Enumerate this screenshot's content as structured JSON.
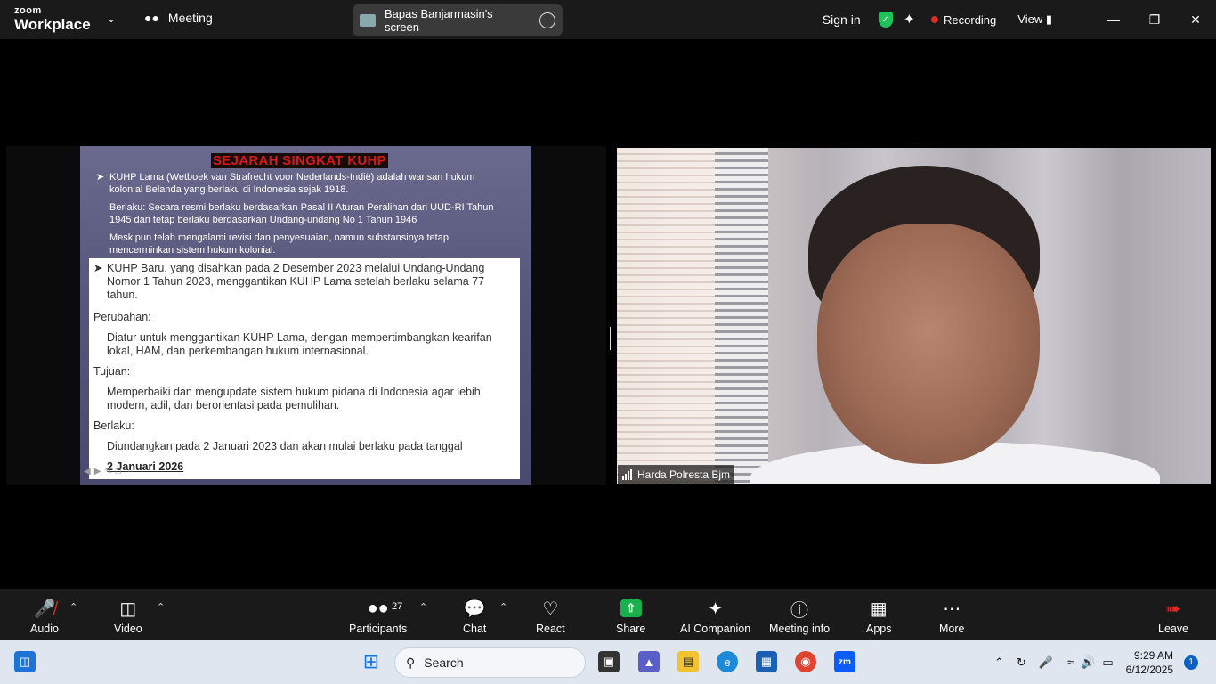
{
  "titlebar": {
    "logo_line1": "zoom",
    "logo_line2": "Workplace",
    "meeting_label": "Meeting",
    "shared_screen_label": "Bapas Banjarmasin's screen",
    "sign_in": "Sign in",
    "recording_label": "Recording",
    "view_label": "View",
    "recording_color": "#e02828",
    "shield_color": "#1fc35a"
  },
  "slide": {
    "title": "SEJARAH SINGKAT KUHP",
    "bullet1": "KUHP Lama (Wetboek van Strafrecht voor Nederlands-Indië) adalah warisan hukum kolonial Belanda yang berlaku di Indonesia sejak 1918.",
    "para2": "Berlaku: Secara resmi berlaku berdasarkan Pasal II Aturan Peralihan dari UUD-RI Tahun 1945 dan tetap berlaku berdasarkan Undang-undang No 1 Tahun 1946",
    "para3": "Meskipun telah mengalami revisi dan penyesuaian, namun substansinya tetap mencerminkan sistem hukum kolonial.",
    "box_bullet": "KUHP Baru, yang disahkan pada 2 Desember 2023 melalui Undang-Undang Nomor 1 Tahun 2023, menggantikan KUHP Lama setelah berlaku selama 77 tahun.",
    "perubahan_head": "Perubahan:",
    "perubahan_text": "Diatur untuk menggantikan KUHP Lama, dengan mempertimbangkan kearifan lokal, HAM, dan perkembangan hukum internasional.",
    "tujuan_head": "Tujuan:",
    "tujuan_text": "Memperbaiki dan mengupdate sistem hukum pidana di Indonesia agar lebih modern, adil, dan berorientasi pada pemulihan.",
    "berlaku_head": "Berlaku:",
    "berlaku_text": "Diundangkan pada 2 Januari 2023 dan akan mulai berlaku pada tanggal",
    "berlaku_date": "2 Januari 2026"
  },
  "video": {
    "participant_name": "Harda Polresta Bjm"
  },
  "toolbar": {
    "audio": "Audio",
    "video": "Video",
    "participants": "Participants",
    "participants_count": "27",
    "chat": "Chat",
    "react": "React",
    "share": "Share",
    "ai_companion": "AI Companion",
    "meeting_info": "Meeting info",
    "apps": "Apps",
    "more": "More",
    "leave": "Leave",
    "share_color": "#19b14d",
    "leave_color": "#e02828"
  },
  "taskbar": {
    "search_placeholder": "Search",
    "time": "9:29 AM",
    "date": "6/12/2025",
    "notification_count": "1"
  }
}
